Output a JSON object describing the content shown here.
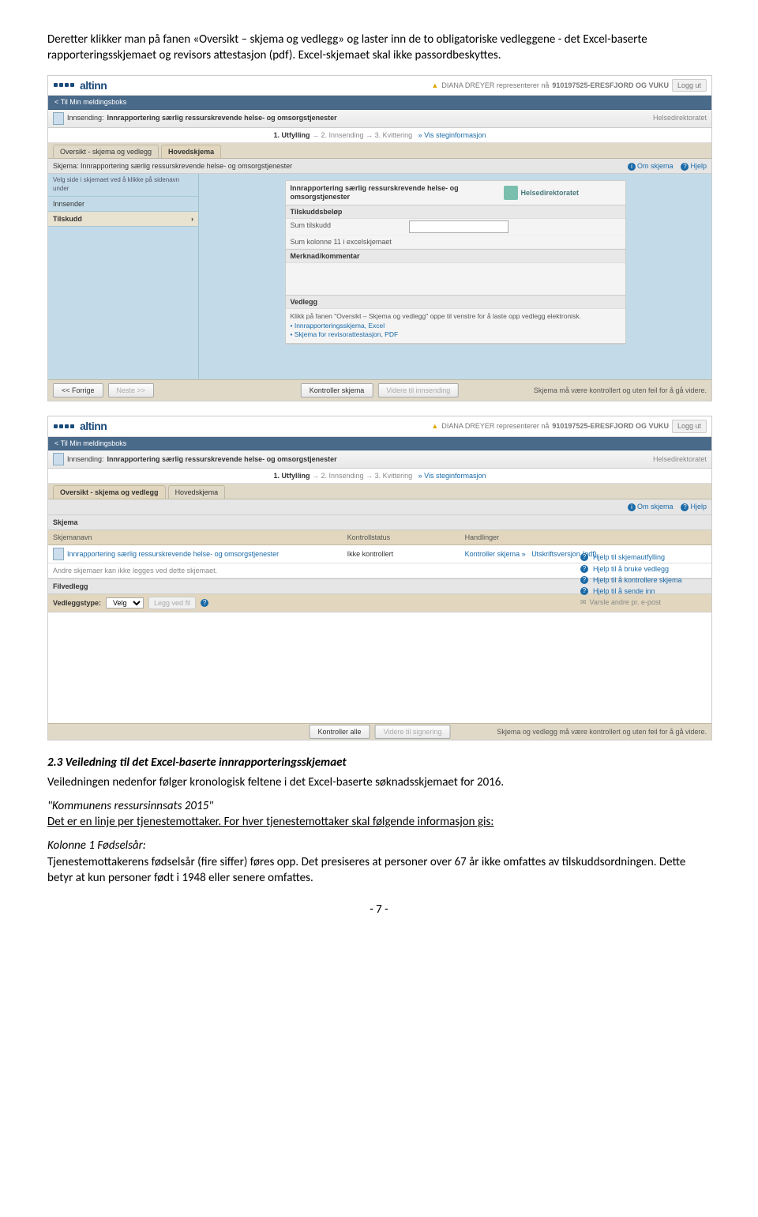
{
  "intro_para": "Deretter klikker man på fanen «Oversikt – skjema og vedlegg» og laster inn de to obligatoriske vedleggene - det Excel-baserte rapporteringsskjemaet og revisors attestasjon (pdf). Excel-skjemaet skal ikke passordbeskyttes.",
  "screenshot1": {
    "logo": "altinn",
    "user_prefix": "DIANA DREYER representerer nå",
    "user_org": "910197525-ERESFJORD OG VUKU",
    "logout": "Logg ut",
    "back": "< Til Min meldingsboks",
    "innsending_label": "Innsending:",
    "innsending_title": "Innrapportering særlig ressurskrevende helse- og omsorgstjenester",
    "hd_label": "Helsedirektoratet",
    "steps": {
      "s1": "1. Utfylling",
      "s2": "2. Innsending",
      "s3": "3. Kvittering",
      "link": "Vis steginformasjon"
    },
    "tab1": "Oversikt - skjema og vedlegg",
    "tab2": "Hovedskjema",
    "skjema_line": "Skjema: Innrapportering særlig ressurskrevende helse- og omsorgstjenester",
    "om_skjema": "Om skjema",
    "hjelp": "Hjelp",
    "side_hint": "Velg side i skjemaet ved å klikke på sidenavn under",
    "side_innsender": "Innsender",
    "side_tilskudd": "Tilskudd",
    "form_title": "Innrapportering særlig ressurskrevende helse- og omsorgstjenester",
    "hdlogo": "Helsedirektoratet",
    "sec_tilskudd": "Tilskuddsbeløp",
    "row_sum_tilskudd": "Sum tilskudd",
    "row_sum_kol": "Sum kolonne 11 i excelskjemaet",
    "sec_merknad": "Merknad/kommentar",
    "sec_vedlegg": "Vedlegg",
    "vedlegg_note": "Klikk på fanen \"Oversikt – Skjema og vedlegg\" oppe til venstre for å laste opp vedlegg elektronisk.",
    "vedlegg_b1": "Innrapporteringsskjema, Excel",
    "vedlegg_b2": "Skjema for revisorattestasjon, PDF",
    "btn_forrige": "<< Forrige",
    "btn_neste": "Neste >>",
    "btn_kontroller": "Kontroller skjema",
    "btn_videre": "Videre til innsending",
    "bottom_msg": "Skjema må være kontrollert og uten feil for å gå videre."
  },
  "screenshot2": {
    "logo": "altinn",
    "user_prefix": "DIANA DREYER representerer nå",
    "user_org": "910197525-ERESFJORD OG VUKU",
    "logout": "Logg ut",
    "back": "< Til Min meldingsboks",
    "innsending_label": "Innsending:",
    "innsending_title": "Innrapportering særlig ressurskrevende helse- og omsorgstjenester",
    "hd_label": "Helsedirektoratet",
    "steps": {
      "s1": "1. Utfylling",
      "s2": "2. Innsending",
      "s3": "3. Kvittering",
      "link": "Vis steginformasjon"
    },
    "tab1": "Oversikt - skjema og vedlegg",
    "tab2": "Hovedskjema",
    "schema_header": "Skjema",
    "col_name": "Skjemanavn",
    "col_ks": "Kontrollstatus",
    "col_h": "Handlinger",
    "row_name": "Innrapportering særlig ressurskrevende helse- og omsorgstjenester",
    "row_ks": "Ikke kontrollert",
    "row_h1": "Kontroller skjema »",
    "row_h2": "Utskriftsversjon (pdf)",
    "sub_note": "Andre skjemaer kan ikke legges ved dette skjemaet.",
    "filvedlegg": "Filvedlegg",
    "vedleggstype": "Vedleggstype:",
    "velg": "Velg",
    "legg_ved": "Legg ved fil",
    "om_skjema": "Om skjema",
    "hjelp": "Hjelp",
    "help_items": [
      "Hjelp til skjemautfylling",
      "Hjelp til å bruke vedlegg",
      "Hjelp til å kontrollere skjema",
      "Hjelp til å sende inn",
      "Varsle andre pr. e-post"
    ],
    "btn_kontroller_alle": "Kontroller alle",
    "btn_videre": "Videre til signering",
    "bottom_msg": "Skjema og vedlegg må være kontrollert og uten feil for å gå videre."
  },
  "section_heading": "2.3 Veiledning til det Excel-baserte innrapporteringsskjemaet",
  "section_intro": "Veiledningen nedenfor følger kronologisk feltene i det Excel-baserte søknadsskjemaet for 2016.",
  "kommune_heading": "\"Kommunens ressursinnsats 2015\"",
  "kommune_line": "Det er en linje per tjenestemottaker. For hver tjenestemottaker skal følgende informasjon gis:",
  "kolonne_heading": "Kolonne 1 Fødselsår:",
  "kolonne_text": "Tjenestemottakerens fødselsår (fire siffer) føres opp. Det presiseres at personer over 67 år ikke omfattes av tilskuddsordningen. Dette betyr at kun personer født i 1948 eller senere omfattes.",
  "page_number": "- 7 -"
}
